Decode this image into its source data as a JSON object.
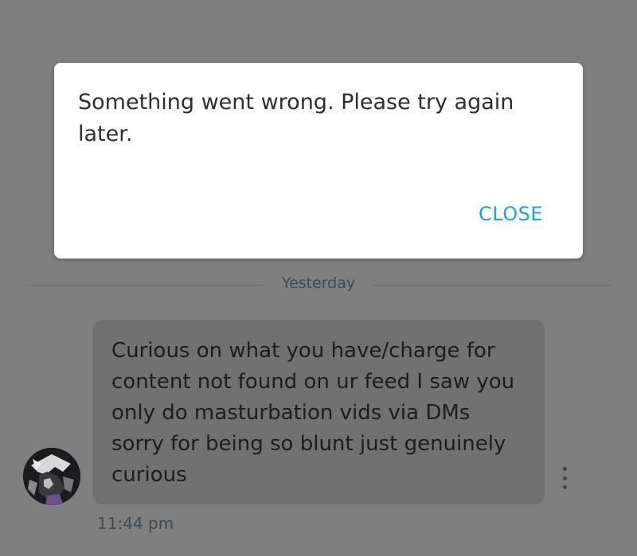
{
  "dialog": {
    "message": "Something went wrong. Please try again later.",
    "close_label": "CLOSE"
  },
  "divider": {
    "label": "Yesterday"
  },
  "message": {
    "text": "Curious on what you have/charge for content not found on ur feed I saw you only do masturbation vids via DMs sorry for being so blunt just genuinely curious",
    "timestamp": "11:44 pm",
    "avatar_icon": "user-avatar",
    "more_icon": "more-vertical-icon"
  },
  "colors": {
    "overlay": "#7f7f7f",
    "dialog_bg": "#ffffff",
    "accent": "#1aa6d6",
    "bubble_bg": "#717171"
  }
}
